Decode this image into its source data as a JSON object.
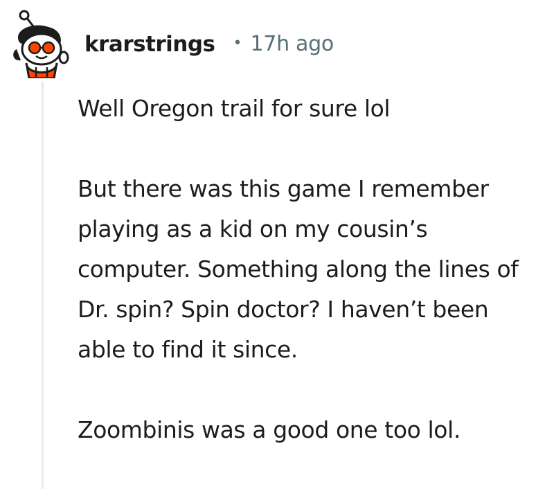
{
  "comment": {
    "author": "krarstrings",
    "separator": "•",
    "timestamp": "17h ago",
    "avatar_icon": "snoo-avatar-icon",
    "paragraphs": [
      "Well Oregon trail for sure lol",
      "But there was this game I remember playing as a kid on my cousin’s computer. Something along the lines of Dr. spin? Spin doctor? I haven’t been able to find it since.",
      "Zoombinis was a good one too lol."
    ]
  },
  "colors": {
    "username": "#1c1c1c",
    "meta": "#576f76",
    "thread_line": "#e5ebee",
    "avatar_accent": "#ff4500"
  }
}
